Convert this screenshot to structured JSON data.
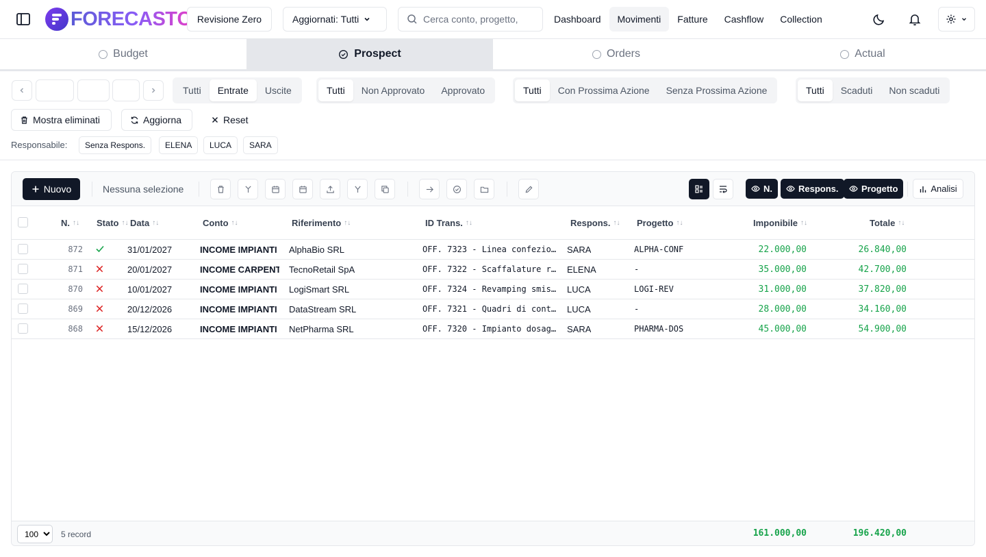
{
  "header": {
    "logo_text": "FORECASTC",
    "revisione_label": "Revisione Zero",
    "aggiornati_label": "Aggiornati: Tutti",
    "search_placeholder": "Cerca conto, progetto,",
    "nav": [
      "Dashboard",
      "Movimenti",
      "Fatture",
      "Cashflow",
      "Collection"
    ],
    "nav_active": "Movimenti"
  },
  "phase_tabs": [
    "Budget",
    "Prospect",
    "Orders",
    "Actual"
  ],
  "phase_active": "Prospect",
  "filters": {
    "tipo": [
      "Tutti",
      "Entrate",
      "Uscite"
    ],
    "tipo_active": "Entrate",
    "approvazione": [
      "Tutti",
      "Non Approvato",
      "Approvato"
    ],
    "approvazione_active": "Tutti",
    "azione": [
      "Tutti",
      "Con Prossima Azione",
      "Senza Prossima Azione"
    ],
    "azione_active": "Tutti",
    "scadenza": [
      "Tutti",
      "Scaduti",
      "Non scaduti"
    ],
    "scadenza_active": "Tutti"
  },
  "actions": {
    "mostra_eliminati": "Mostra eliminati",
    "aggiorna": "Aggiorna",
    "reset": "Reset"
  },
  "responsabile": {
    "label": "Responsabile:",
    "chips": [
      "Senza Respons.",
      "ELENA",
      "LUCA",
      "SARA"
    ]
  },
  "toolbar": {
    "nuovo_label": "Nuovo",
    "selection_text": "Nessuna selezione",
    "column_toggles": [
      "N.",
      "Respons.",
      "Progetto"
    ],
    "analisi_label": "Analisi"
  },
  "table": {
    "columns": [
      "N.",
      "Stato",
      "Data",
      "Conto",
      "Riferimento",
      "ID Trans.",
      "Respons.",
      "Progetto",
      "Imponibile",
      "Totale"
    ],
    "rows": [
      {
        "n": "872",
        "stato": "ok",
        "data": "31/01/2027",
        "conto": "INCOME IMPIANTI",
        "riferimento": "AlphaBio SRL",
        "id_trans": "OFF. 7323 - Linea confezio…",
        "respons": "SARA",
        "progetto": "ALPHA-CONF",
        "imponibile": "22.000,00",
        "totale": "26.840,00"
      },
      {
        "n": "871",
        "stato": "ko",
        "data": "20/01/2027",
        "conto": "INCOME CARPENT…",
        "riferimento": "TecnoRetail SpA",
        "id_trans": "OFF. 7322 - Scaffalature r…",
        "respons": "ELENA",
        "progetto": "-",
        "imponibile": "35.000,00",
        "totale": "42.700,00"
      },
      {
        "n": "870",
        "stato": "ko",
        "data": "10/01/2027",
        "conto": "INCOME IMPIANTI",
        "riferimento": "LogiSmart SRL",
        "id_trans": "OFF. 7324 - Revamping smis…",
        "respons": "LUCA",
        "progetto": "LOGI-REV",
        "imponibile": "31.000,00",
        "totale": "37.820,00"
      },
      {
        "n": "869",
        "stato": "ko",
        "data": "20/12/2026",
        "conto": "INCOME IMPIANTI",
        "riferimento": "DataStream SRL",
        "id_trans": "OFF. 7321 - Quadri di cont…",
        "respons": "LUCA",
        "progetto": "-",
        "imponibile": "28.000,00",
        "totale": "34.160,00"
      },
      {
        "n": "868",
        "stato": "ko",
        "data": "15/12/2026",
        "conto": "INCOME IMPIANTI",
        "riferimento": "NetPharma SRL",
        "id_trans": "OFF. 7320 - Impianto dosag…",
        "respons": "SARA",
        "progetto": "PHARMA-DOS",
        "imponibile": "45.000,00",
        "totale": "54.900,00"
      }
    ]
  },
  "footer": {
    "page_size": "100",
    "record_count": "5 record",
    "total_imponibile": "161.000,00",
    "total_totale": "196.420,00"
  },
  "colors": {
    "accent_dark": "#111827",
    "money_green": "#16a34a",
    "status_ok": "#16a34a",
    "status_ko": "#dc2626"
  }
}
